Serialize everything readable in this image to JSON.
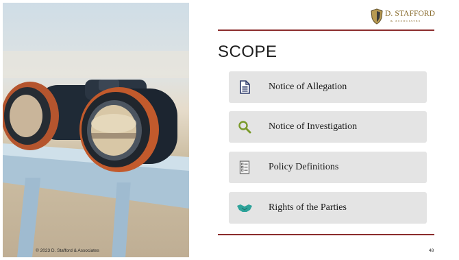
{
  "slide": {
    "title": "SCOPE",
    "copyright": "© 2023 D. Stafford & Associates",
    "page_number": "48"
  },
  "logo": {
    "name": "D. STAFFORD",
    "subtitle": "& ASSOCIATES",
    "accent_color": "#8a6d2f"
  },
  "rule_color": "#8b2c2c",
  "items": [
    {
      "label": "Notice of Allegation",
      "icon": "document-icon",
      "icon_color": "#2f3b6b"
    },
    {
      "label": "Notice of Investigation",
      "icon": "magnifier-icon",
      "icon_color": "#7a9a2a"
    },
    {
      "label": "Policy Definitions",
      "icon": "checklist-icon",
      "icon_color": "#6a6a6a"
    },
    {
      "label": "Rights of the Parties",
      "icon": "handshake-icon",
      "icon_color": "#2ea39a"
    }
  ]
}
